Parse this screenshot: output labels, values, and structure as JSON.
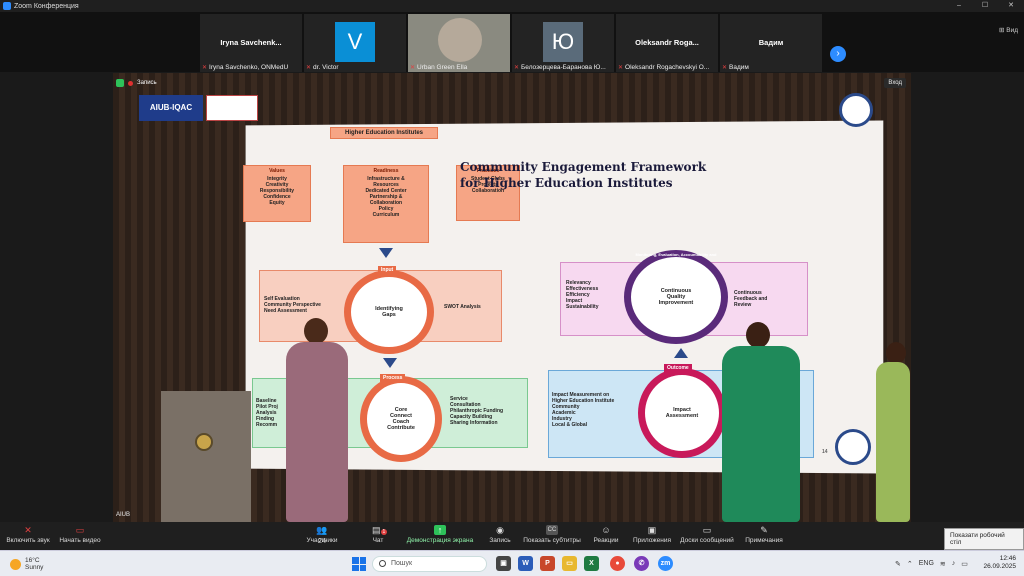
{
  "window": {
    "title": "Zoom Конференция",
    "minimize": "–",
    "maximize": "☐",
    "close": "✕"
  },
  "participants_strip": [
    {
      "name": "Iryna  Savchenk...",
      "caption": "Iryna Savchenko, ONMedU",
      "type": "name"
    },
    {
      "name": "V",
      "caption": "dr. Victor",
      "type": "avatar",
      "color": "#0a8fd6"
    },
    {
      "name": "",
      "caption": "Urban Green Ella",
      "type": "video"
    },
    {
      "name": "Ю",
      "caption": "Белозерцева-Баранова Ю...",
      "type": "avatar",
      "color": "#5a6b7a"
    },
    {
      "name": "Oleksandr  Roga...",
      "caption": "Oleksandr Rogachevskyi O...",
      "type": "name"
    },
    {
      "name": "Вадим",
      "caption": "Вадим",
      "type": "name"
    }
  ],
  "view_button": "⊞ Вид",
  "recording_label": "Запись",
  "enter_label": "Вход",
  "host_tag": "AIUB",
  "slide": {
    "title": "Community Engagement Framework for Higher Education Institutes",
    "header_box": "Higher Education Institutes",
    "values": {
      "heading": "Values",
      "items": "Integrity\nCreativity\nResponsibility\nConfidence\nEquity"
    },
    "readiness": {
      "heading": "Readiness",
      "items": "Infrastructure &\nResources\nDedicated Center\nPartnership &\nCollaboration\nPolicy\nCurriculum"
    },
    "practices": {
      "heading": "Practices",
      "items": "Student Clubs\nProjects\nCollaboration"
    },
    "input": {
      "label": "Input",
      "ring": "Identifying\nGaps",
      "left": "Self Evaluation\nCommunity Perspective\nNeed Assessment",
      "right": "SWOT Analysis"
    },
    "process": {
      "label": "Process",
      "ring": "Core\nConnect\nCoach\nContribute",
      "left": "Baseline\nPilot Proj\nAnalysis\nFinding\nRecomm",
      "right": "Service\nConsultation\nPhilanthropic Funding\nCapacity Building\nSharing Information"
    },
    "outcome": {
      "label": "Outcome",
      "ring": "Impact\nAssessment",
      "left": "Impact Measurement on\nHigher Education Institute\nCommunity\nAcademic\nIndustry\nLocal & Global"
    },
    "ceq": {
      "ring": "Continuous\nQuality\nImprovement",
      "arc": "Monitoring, Evaluation, Accountability and Learning",
      "left": "Relevancy\nEffectiveness\nEfficiency\nImpact\nSustainability",
      "right": "Continuous\nFeedback and\nReview"
    },
    "logo_left": "AIUB-IQAC",
    "page": "14"
  },
  "toolbar": [
    {
      "key": "mute",
      "label": "Включить звук",
      "icon": "🎤"
    },
    {
      "key": "video",
      "label": "Начать видео",
      "icon": "📷"
    },
    {
      "key": "participants",
      "label": "Участники",
      "icon": "👥",
      "badge": "24"
    },
    {
      "key": "chat",
      "label": "Чат",
      "icon": "💬",
      "badge": "1"
    },
    {
      "key": "share",
      "label": "Демонстрация экрана",
      "icon": "↑"
    },
    {
      "key": "record",
      "label": "Запись",
      "icon": "◉"
    },
    {
      "key": "cc",
      "label": "Показать субтитры",
      "icon": "CC"
    },
    {
      "key": "reactions",
      "label": "Реакции",
      "icon": "☺"
    },
    {
      "key": "apps",
      "label": "Приложения",
      "icon": "▣"
    },
    {
      "key": "whiteboards",
      "label": "Доски сообщений",
      "icon": "▭"
    },
    {
      "key": "notes",
      "label": "Примечания",
      "icon": "✎"
    }
  ],
  "tooltip": "Показати робочий стіл",
  "taskbar": {
    "temp": "16°C",
    "condition": "Sunny",
    "search_placeholder": "Пошук",
    "lang": "ENG",
    "time": "12:46",
    "date": "26.09.2025"
  }
}
